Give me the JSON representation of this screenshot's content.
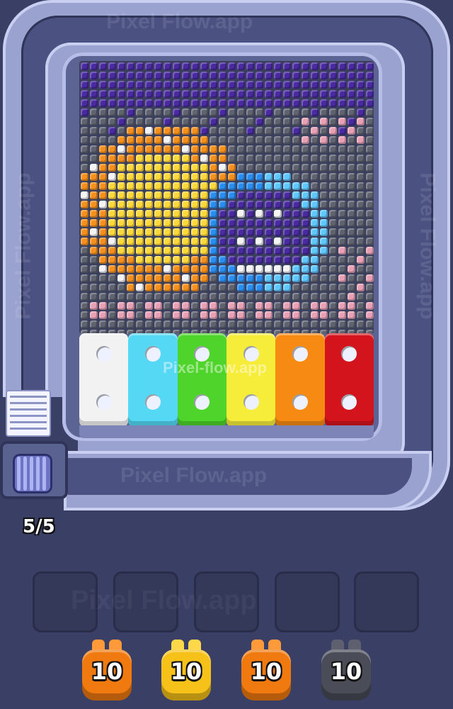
{
  "watermarks": {
    "top": "Pixel Flow.app",
    "center": "Pixel-flow.app",
    "bottom": "Pixel Flow.app",
    "left": "Pixel Flow.app",
    "right": "Pixel Flow.app",
    "slots": "Pixel Flow.app"
  },
  "ammo_counter": "5/5",
  "palette": {
    "purple": "#4a2aa0",
    "grey": "#5f6370",
    "pink": "#e8a0b4",
    "yellow": "#ffd83a",
    "orange": "#f5901c",
    "white": "#f4f4f4",
    "blue": "#2a8ef0",
    "lightblue": "#5fc8ff"
  },
  "buckets": [
    {
      "color": "white",
      "hex": "#f2f2f2"
    },
    {
      "color": "cyan",
      "hex": "#55d8f4"
    },
    {
      "color": "green",
      "hex": "#4ed42a"
    },
    {
      "color": "yellow",
      "hex": "#f6ec3a"
    },
    {
      "color": "orange",
      "hex": "#f68a12"
    },
    {
      "color": "red",
      "hex": "#d4141c"
    }
  ],
  "slots": [
    {
      "state": "empty"
    },
    {
      "state": "empty"
    },
    {
      "state": "empty"
    },
    {
      "state": "empty"
    },
    {
      "state": "empty"
    }
  ],
  "shooters": [
    {
      "count": "10",
      "color": "orange",
      "hex": "#f07a10",
      "ear": "#ff9a3a"
    },
    {
      "count": "10",
      "color": "yellow",
      "hex": "#f6c21a",
      "ear": "#ffd84a"
    },
    {
      "count": "10",
      "color": "orange",
      "hex": "#f07a10",
      "ear": "#ff9a3a"
    },
    {
      "count": "10",
      "color": "dark-grey",
      "hex": "#4a4c58",
      "ear": "#5e6070"
    }
  ]
}
